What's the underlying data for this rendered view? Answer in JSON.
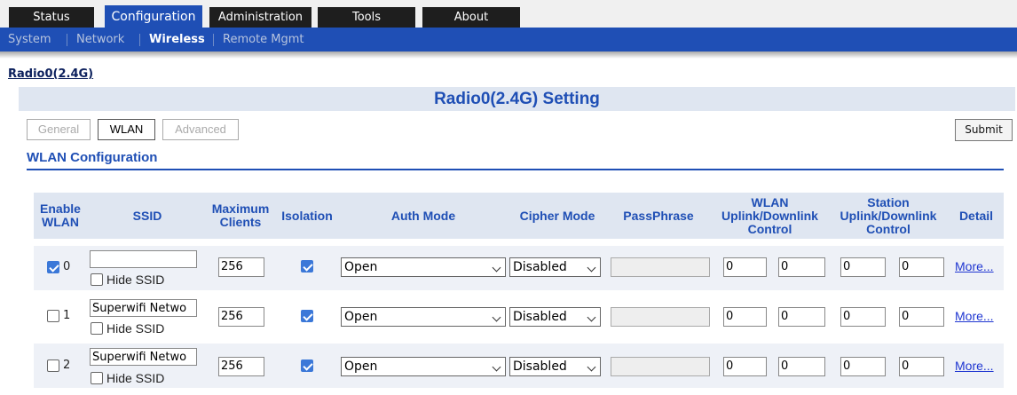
{
  "top_tabs": [
    {
      "label": "Status",
      "active": false
    },
    {
      "label": "Configuration",
      "active": true
    },
    {
      "label": "Administration",
      "active": false
    },
    {
      "label": "Tools",
      "active": false
    },
    {
      "label": "About",
      "active": false
    }
  ],
  "sub_nav": [
    {
      "label": "System",
      "active": false
    },
    {
      "label": "Network",
      "active": false
    },
    {
      "label": "Wireless",
      "active": true
    },
    {
      "label": "Remote Mgmt",
      "active": false
    }
  ],
  "radio_link": "Radio0(2.4G)",
  "setting_title": "Radio0(2.4G) Setting",
  "sub_tabs": [
    {
      "label": "General",
      "active": false
    },
    {
      "label": "WLAN",
      "active": true
    },
    {
      "label": "Advanced",
      "active": false
    }
  ],
  "submit_label": "Submit",
  "section_title": "WLAN Configuration",
  "columns": {
    "enable": [
      "Enable",
      "WLAN"
    ],
    "ssid": "SSID",
    "max_clients": [
      "Maximum",
      "Clients"
    ],
    "isolation": "Isolation",
    "auth_mode": "Auth Mode",
    "cipher_mode": "Cipher Mode",
    "passphrase": "PassPhrase",
    "wlan_control": [
      "WLAN",
      "Uplink/Downlink",
      "Control"
    ],
    "station_control": [
      "Station",
      "Uplink/Downlink",
      "Control"
    ],
    "detail": "Detail"
  },
  "hide_ssid_label": "Hide SSID",
  "more_label": "More...",
  "rows": [
    {
      "index": "0",
      "enabled": true,
      "ssid": "",
      "hide_ssid": false,
      "max_clients": "256",
      "isolation": true,
      "auth_mode": "Open",
      "cipher_mode": "Disabled",
      "passphrase": "",
      "wlan_up": "0",
      "wlan_down": "0",
      "station_up": "0",
      "station_down": "0"
    },
    {
      "index": "1",
      "enabled": false,
      "ssid": "Superwifi Netwo",
      "hide_ssid": false,
      "max_clients": "256",
      "isolation": true,
      "auth_mode": "Open",
      "cipher_mode": "Disabled",
      "passphrase": "",
      "wlan_up": "0",
      "wlan_down": "0",
      "station_up": "0",
      "station_down": "0"
    },
    {
      "index": "2",
      "enabled": false,
      "ssid": "Superwifi Netwo",
      "hide_ssid": false,
      "max_clients": "256",
      "isolation": true,
      "auth_mode": "Open",
      "cipher_mode": "Disabled",
      "passphrase": "",
      "wlan_up": "0",
      "wlan_down": "0",
      "station_up": "0",
      "station_down": "0"
    }
  ],
  "colors": {
    "accent": "#1f4fb5",
    "header_bg": "#dfe6f1",
    "row_shade": "#eef1f7",
    "tab_dark": "#1e1e1e",
    "link": "#1f36d1"
  }
}
